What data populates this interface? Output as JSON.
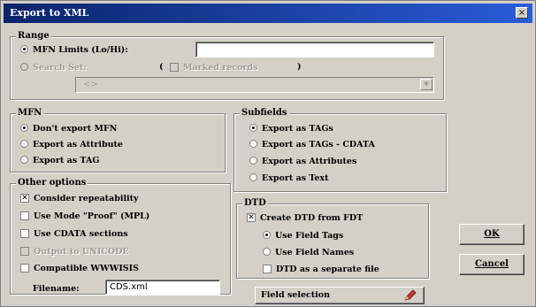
{
  "window": {
    "title": "Export to XML",
    "close_symbol": "×"
  },
  "range": {
    "label": "Range",
    "mfn_limits": "MFN Limits (Lo/Hi):",
    "search_set": "Search Set:",
    "paren_open": "(",
    "marked_records": "Marked records",
    "paren_close": ")",
    "mfn_limits_value": "",
    "search_set_value": "<>",
    "combo_arrow": "▼"
  },
  "mfn": {
    "label": "MFN",
    "options": [
      "Don't export MFN",
      "Export as Attribute",
      "Export as TAG"
    ]
  },
  "subfields": {
    "label": "Subfields",
    "options": [
      "Export as TAGs",
      "Export as TAGs - CDATA",
      "Export as Attributes",
      "Export as Text"
    ]
  },
  "other": {
    "label": "Other options",
    "options": [
      "Consider repeatability",
      "Use Mode \"Proof\" (MPL)",
      "Use CDATA sections",
      "Output to UNICODE",
      "Compatible WWWISIS"
    ],
    "filename_label": "Filename:",
    "filename_value": "CDS.xml"
  },
  "dtd": {
    "label": "DTD",
    "create": "Create DTD from FDT",
    "options": [
      "Use Field Tags",
      "Use Field Names"
    ],
    "separate": "DTD as a separate file"
  },
  "buttons": {
    "ok": "OK",
    "cancel": "Cancel",
    "field_selection": "Field selection"
  },
  "check_mark": "✕"
}
